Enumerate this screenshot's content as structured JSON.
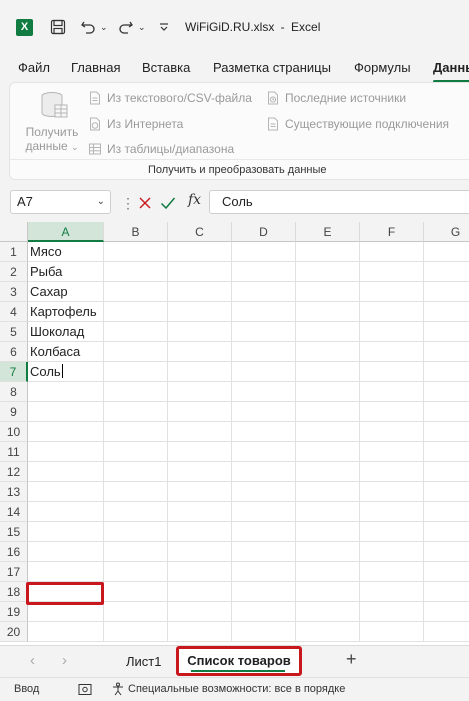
{
  "titlebar": {
    "app_icon": "excel-icon",
    "file_title": "WiFiGiD.RU.xlsx",
    "separator": "-",
    "app_name": "Excel"
  },
  "ribbon_tabs": [
    {
      "label": "Файл",
      "active": false
    },
    {
      "label": "Главная",
      "active": false
    },
    {
      "label": "Вставка",
      "active": false
    },
    {
      "label": "Разметка страницы",
      "active": false
    },
    {
      "label": "Формулы",
      "active": false
    },
    {
      "label": "Данные",
      "active": true
    }
  ],
  "ribbon": {
    "get_data": {
      "line1": "Получить",
      "line2": "данные"
    },
    "from_text_csv": "Из текстового/CSV-файла",
    "from_web": "Из Интернета",
    "from_table": "Из таблицы/диапазона",
    "recent_sources": "Последние источники",
    "existing_connections": "Существующие подключения",
    "group_label": "Получить и преобразовать данные"
  },
  "formula_bar": {
    "name_box": "A7",
    "fx": "fx",
    "content": "Соль"
  },
  "grid": {
    "columns": [
      "A",
      "B",
      "C",
      "D",
      "E",
      "F",
      "G"
    ],
    "rows": [
      "1",
      "2",
      "3",
      "4",
      "5",
      "6",
      "7",
      "8",
      "9",
      "10",
      "11",
      "12",
      "13",
      "14",
      "15",
      "16",
      "17",
      "18",
      "19",
      "20"
    ],
    "column_a_values": [
      "Мясо",
      "Рыба",
      "Сахар",
      "Картофель",
      "Шоколад",
      "Колбаса",
      "Соль"
    ],
    "active_cell": "A7"
  },
  "sheets": {
    "tabs": [
      "Лист1",
      "Список товаров"
    ],
    "active": "Список товаров",
    "add_label": "+"
  },
  "statusbar": {
    "mode": "Ввод",
    "accessibility": "Специальные возможности: все в порядке"
  },
  "colors": {
    "excel_green": "#107c41",
    "highlight_red": "#c8171d"
  }
}
